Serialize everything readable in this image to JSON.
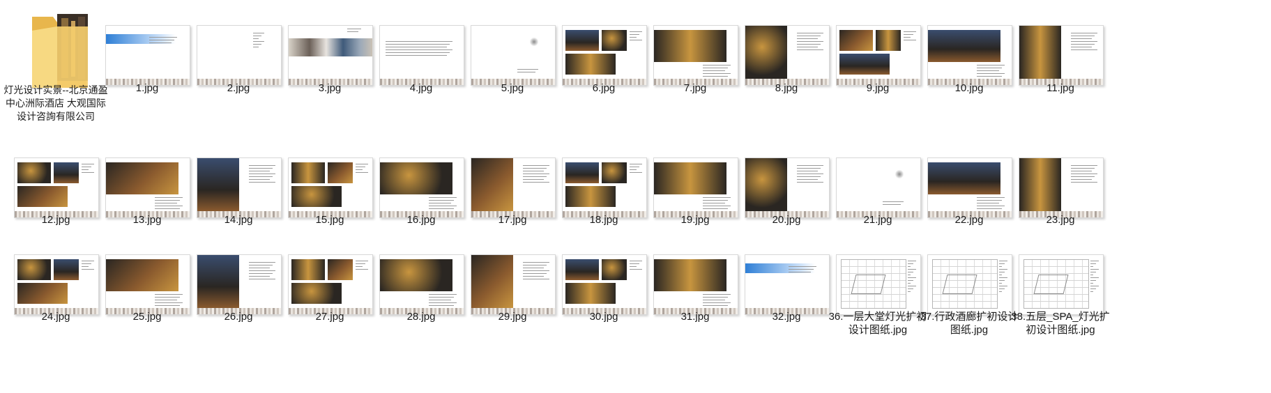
{
  "folder": {
    "name": "灯光设计实景--北京通盈中心洲际酒店 大观国际设计咨詢有限公司",
    "icon": "folder-icon"
  },
  "files": [
    {
      "name": "1.jpg",
      "kind": "cover"
    },
    {
      "name": "2.jpg",
      "kind": "blank"
    },
    {
      "name": "3.jpg",
      "kind": "strip"
    },
    {
      "name": "4.jpg",
      "kind": "text"
    },
    {
      "name": "5.jpg",
      "kind": "logo"
    },
    {
      "name": "6.jpg",
      "kind": "photo"
    },
    {
      "name": "7.jpg",
      "kind": "photo"
    },
    {
      "name": "8.jpg",
      "kind": "photo"
    },
    {
      "name": "9.jpg",
      "kind": "photo"
    },
    {
      "name": "10.jpg",
      "kind": "photo"
    },
    {
      "name": "11.jpg",
      "kind": "photo"
    },
    {
      "name": "12.jpg",
      "kind": "photo"
    },
    {
      "name": "13.jpg",
      "kind": "photo"
    },
    {
      "name": "14.jpg",
      "kind": "photo"
    },
    {
      "name": "15.jpg",
      "kind": "photo"
    },
    {
      "name": "16.jpg",
      "kind": "photo"
    },
    {
      "name": "17.jpg",
      "kind": "photo"
    },
    {
      "name": "18.jpg",
      "kind": "photo"
    },
    {
      "name": "19.jpg",
      "kind": "photo"
    },
    {
      "name": "20.jpg",
      "kind": "photo"
    },
    {
      "name": "21.jpg",
      "kind": "logo"
    },
    {
      "name": "22.jpg",
      "kind": "photo"
    },
    {
      "name": "23.jpg",
      "kind": "photo"
    },
    {
      "name": "24.jpg",
      "kind": "photo"
    },
    {
      "name": "25.jpg",
      "kind": "photo"
    },
    {
      "name": "26.jpg",
      "kind": "photo"
    },
    {
      "name": "27.jpg",
      "kind": "photo"
    },
    {
      "name": "28.jpg",
      "kind": "photo"
    },
    {
      "name": "29.jpg",
      "kind": "photo"
    },
    {
      "name": "30.jpg",
      "kind": "photo"
    },
    {
      "name": "31.jpg",
      "kind": "photo"
    },
    {
      "name": "32.jpg",
      "kind": "cover"
    },
    {
      "name": "36.一层大堂灯光扩初设计图纸.jpg",
      "kind": "drawing"
    },
    {
      "name": "37.行政酒廊扩初设计图纸.jpg",
      "kind": "drawing"
    },
    {
      "name": "38.五层_SPA_灯光扩初设计图纸.jpg",
      "kind": "drawing"
    }
  ],
  "colors": {
    "accent_blue": "#2f7fd6",
    "photo_dark": "#2a2622",
    "photo_warm": "#8a5a2e",
    "photo_gold": "#c8953f",
    "photo_blue": "#3a4d6e"
  }
}
